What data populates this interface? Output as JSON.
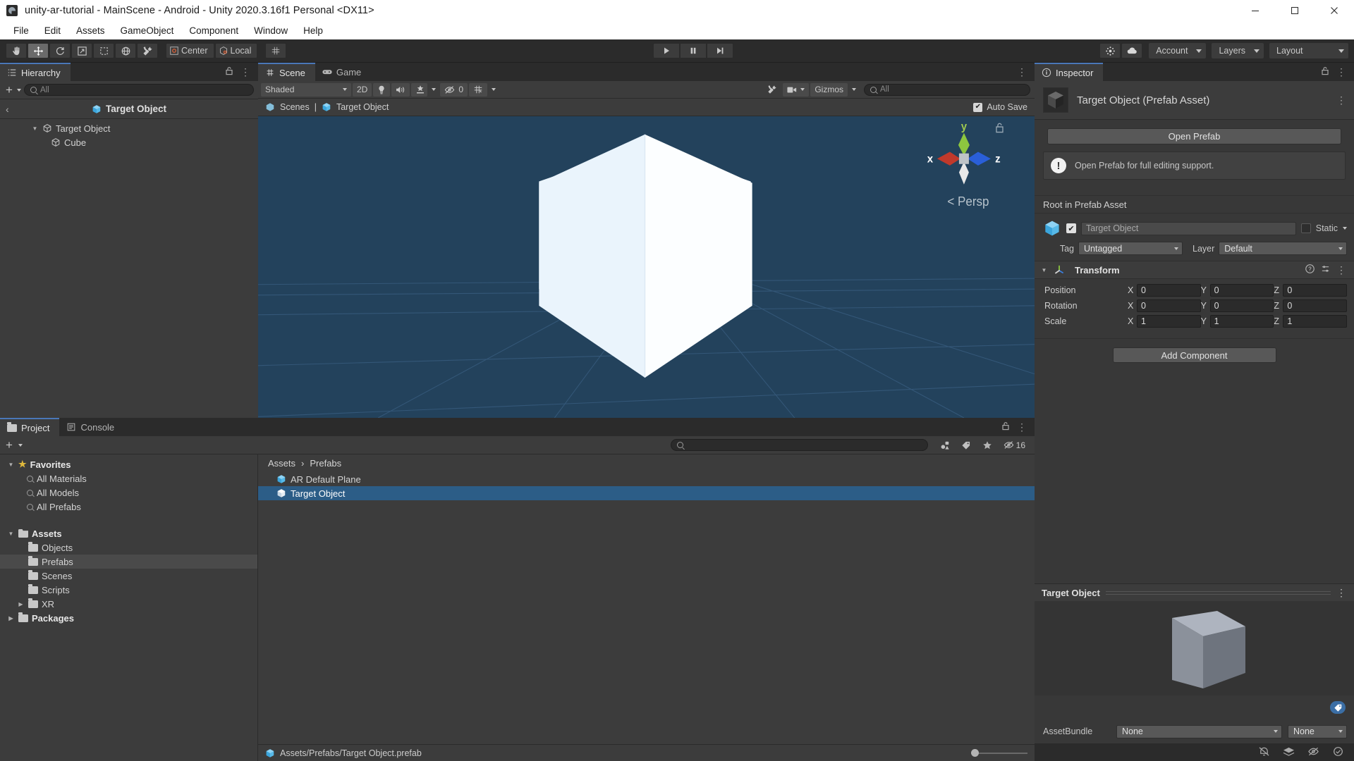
{
  "window": {
    "title": "unity-ar-tutorial - MainScene - Android - Unity 2020.3.16f1 Personal <DX11>",
    "minimize_label": "minimize-icon",
    "maximize_label": "maximize-icon",
    "close_label": "close-icon"
  },
  "menubar": {
    "items": [
      "File",
      "Edit",
      "Assets",
      "GameObject",
      "Component",
      "Window",
      "Help"
    ]
  },
  "toolbar": {
    "tools": [
      {
        "name": "hand-tool",
        "icon": "hand",
        "active": false
      },
      {
        "name": "move-tool",
        "icon": "move",
        "active": true
      },
      {
        "name": "rotate-tool",
        "icon": "rotate",
        "active": false
      },
      {
        "name": "scale-tool",
        "icon": "scale",
        "active": false
      },
      {
        "name": "rect-tool",
        "icon": "rect",
        "active": false
      },
      {
        "name": "transform-tool",
        "icon": "transform",
        "active": false
      },
      {
        "name": "custom-tool",
        "icon": "wrench",
        "active": false
      }
    ],
    "pivot_label": "Center",
    "space_label": "Local",
    "grid_label": "grid-snap",
    "play_label": "play-icon",
    "pause_label": "pause-icon",
    "step_label": "step-icon",
    "collab_label": "cloud-icon",
    "services_label": "services-icon",
    "account_label": "Account",
    "layers_label": "Layers",
    "layout_label": "Layout"
  },
  "hierarchy": {
    "tab_label": "Hierarchy",
    "search_placeholder": "All",
    "prefab_header": "Target Object",
    "tree": [
      {
        "label": "Target Object",
        "depth": 0,
        "expanded": true
      },
      {
        "label": "Cube",
        "depth": 1,
        "expanded": false
      }
    ]
  },
  "scene": {
    "tabs": [
      {
        "label": "Scene",
        "selected": true
      },
      {
        "label": "Game",
        "selected": false
      }
    ],
    "draw_mode": "Shaded",
    "two_d_label": "2D",
    "lighting_label": "lighting-icon",
    "audio_label": "audio-icon",
    "fx_label": "effects-icon",
    "hidden_count": "0",
    "grid_label": "grid-icon",
    "tools_label": "scene-tools-icon",
    "camera_label": "camera-icon",
    "gizmos_label": "Gizmos",
    "search_placeholder": "All",
    "breadcrumb": [
      "Scenes",
      "Target Object"
    ],
    "autosave_label": "Auto Save",
    "autosave_checked": true,
    "gizmo": {
      "x_label": "x",
      "y_label": "y",
      "z_label": "z",
      "projection_label": "Persp"
    }
  },
  "project": {
    "tabs": [
      {
        "label": "Project",
        "selected": true
      },
      {
        "label": "Console",
        "selected": false
      }
    ],
    "search_placeholder": "",
    "visible_count": "16",
    "tree": [
      {
        "label": "Favorites",
        "depth": 0,
        "kind": "star",
        "expanded": true,
        "selected": false
      },
      {
        "label": "All Materials",
        "depth": 1,
        "kind": "search",
        "expanded": null,
        "selected": false
      },
      {
        "label": "All Models",
        "depth": 1,
        "kind": "search",
        "expanded": null,
        "selected": false
      },
      {
        "label": "All Prefabs",
        "depth": 1,
        "kind": "search",
        "expanded": null,
        "selected": false
      },
      {
        "label": "Assets",
        "depth": 0,
        "kind": "folder-open",
        "expanded": true,
        "selected": false
      },
      {
        "label": "Objects",
        "depth": 1,
        "kind": "folder",
        "expanded": null,
        "selected": false
      },
      {
        "label": "Prefabs",
        "depth": 1,
        "kind": "folder",
        "expanded": null,
        "selected": true
      },
      {
        "label": "Scenes",
        "depth": 1,
        "kind": "folder",
        "expanded": null,
        "selected": false
      },
      {
        "label": "Scripts",
        "depth": 1,
        "kind": "folder",
        "expanded": null,
        "selected": false
      },
      {
        "label": "XR",
        "depth": 1,
        "kind": "folder",
        "expanded": false,
        "selected": false
      },
      {
        "label": "Packages",
        "depth": 0,
        "kind": "folder",
        "expanded": false,
        "selected": false
      }
    ],
    "breadcrumbs": [
      "Assets",
      "Prefabs"
    ],
    "assets": [
      {
        "label": "AR Default Plane",
        "selected": false
      },
      {
        "label": "Target Object",
        "selected": true
      }
    ],
    "status_path": "Assets/Prefabs/Target Object.prefab"
  },
  "inspector": {
    "tab_label": "Inspector",
    "asset_title": "Target Object (Prefab Asset)",
    "open_prefab_label": "Open Prefab",
    "help_text": "Open Prefab for full editing support.",
    "root_label": "Root in Prefab Asset",
    "object_name": "Target Object",
    "object_enabled": true,
    "static_label": "Static",
    "tag_label": "Tag",
    "tag_value": "Untagged",
    "layer_label": "Layer",
    "layer_value": "Default",
    "transform": {
      "title": "Transform",
      "rows": [
        {
          "label": "Position",
          "x": "0",
          "y": "0",
          "z": "0"
        },
        {
          "label": "Rotation",
          "x": "0",
          "y": "0",
          "z": "0"
        },
        {
          "label": "Scale",
          "x": "1",
          "y": "1",
          "z": "1"
        }
      ],
      "axis_labels": [
        "X",
        "Y",
        "Z"
      ]
    },
    "add_component_label": "Add Component",
    "preview_title": "Target Object",
    "assetbundle_label": "AssetBundle",
    "assetbundle_value": "None",
    "assetbundle_variant": "None"
  },
  "colors": {
    "accent_blue": "#2c5d87",
    "tab_selected_underline": "#4a77b8",
    "prefab_cube": "#57b9e8",
    "viewport_bg": "#23425c",
    "axis_x": "#c0392b",
    "axis_y": "#8cc63f",
    "axis_z": "#2a5fd8",
    "star_yellow": "#e0b93c"
  }
}
